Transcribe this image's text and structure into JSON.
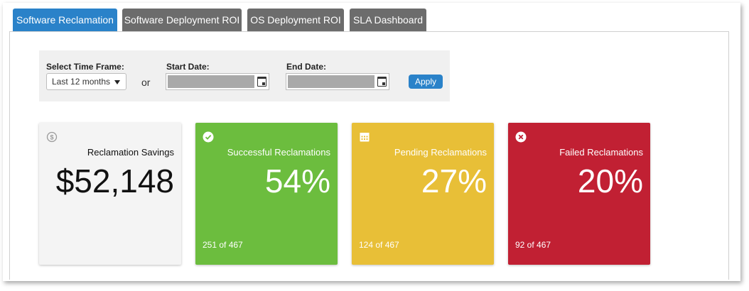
{
  "tabs": [
    {
      "label": "Software Reclamation",
      "active": true
    },
    {
      "label": "Software Deployment ROI",
      "active": false
    },
    {
      "label": "OS Deployment ROI",
      "active": false
    },
    {
      "label": "SLA Dashboard",
      "active": false
    }
  ],
  "filter": {
    "time_frame_label": "Select Time Frame:",
    "time_frame_value": "Last 12 months",
    "or_text": "or",
    "start_label": "Start Date:",
    "start_value": "",
    "end_label": "End Date:",
    "end_value": "",
    "apply_label": "Apply"
  },
  "cards": {
    "savings": {
      "title": "Reclamation Savings",
      "value": "$52,148",
      "icon": "dollar-icon"
    },
    "successful": {
      "title": "Successful Reclamations",
      "value": "54%",
      "count": "251 of 467",
      "icon": "check-circle-icon",
      "color": "#6cbd3e"
    },
    "pending": {
      "title": "Pending Reclamations",
      "value": "27%",
      "count": "124 of 467",
      "icon": "calendar-icon",
      "color": "#e8bf37"
    },
    "failed": {
      "title": "Failed Reclamations",
      "value": "20%",
      "count": "92 of 467",
      "icon": "x-circle-icon",
      "color": "#c12033"
    }
  },
  "colors": {
    "accent": "#2a82c9",
    "inactive_tab": "#6c6c6c"
  }
}
